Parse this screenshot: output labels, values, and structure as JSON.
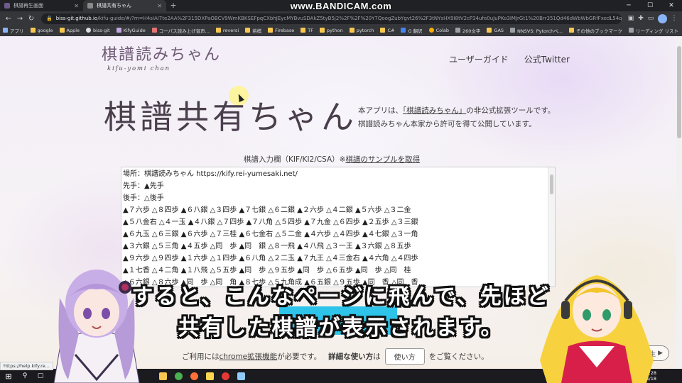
{
  "watermark": "www.BANDICAM.com",
  "browser": {
    "tabs": [
      {
        "title": "棋譜再生画面",
        "favicon_color": "#6f5a8c",
        "active": false
      },
      {
        "title": "棋譜共有ちゃん",
        "favicon_color": "#8a8a8a",
        "active": true
      }
    ],
    "new_tab": "+",
    "url_host": "biss-git.github.io",
    "url_path": "/kifu-guide/#/?m=H4sIAI7te2AA%2F315DXPaOBCV9WmKBKSEFpqCXbhJEycMYBvuSDAkZ5tyB5j2%2F%2F%20Y7QoogZubYgvt26%2F3tNYsHX9I8tV2cP34ufe0uJuPKo3IMJrGt1%20Brr351Qd46dWbWbGRfFxedL54qu3ewxZCgCgHWPbDb...",
    "bookmarks": [
      "アプリ",
      "google",
      "Apple",
      "biss-git",
      "KifyGuide",
      "コーパス読み上げ音声...",
      "reversi",
      "将棋",
      "Firebase",
      "TF",
      "python",
      "pytorch",
      "C#",
      "G 翻訳",
      "Colab",
      "260文字",
      "GAS",
      "NNSVS: Pytorchベ..."
    ],
    "bookmarks_right": [
      "その他のブックマーク",
      "リーディング リスト"
    ]
  },
  "header": {
    "logo_title": "棋譜読みちゃん",
    "logo_subtitle": "kifu-yomi chan",
    "nav": [
      "ユーザーガイド",
      "公式Twitter"
    ]
  },
  "hero": {
    "title": "棋譜共有ちゃん",
    "desc_pre": "本アプリは、",
    "desc_link": "「棋譜読みちゃん」",
    "desc_post": "の非公式拡張ツールです。",
    "desc_line2": "棋譜読みちゃん本家から許可を得て公開しています。"
  },
  "input": {
    "label": "棋譜入力欄（KIF/KI2/CSA）※",
    "sample_link": "棋譜のサンプルを取得",
    "lines": [
      "場所：棋譜読みちゃん https://kify.rei-yumesaki.net/",
      "先手：▲先手",
      "後手：△後手",
      "▲７六歩 △８四歩 ▲６八銀 △３四歩 ▲７七銀 △６二銀 ▲２六歩 △４二銀 ▲５六歩 △３二金",
      "▲５八金右 △４一玉 ▲４八銀 △７四歩 ▲７八角 △５四歩 ▲７九金 △６四歩 ▲２五歩 △３三銀",
      "▲６九玉 △６三銀 ▲６六歩 △７三桂 ▲６七金右 △５二金 ▲４六歩 △４四歩 ▲４七銀 △３一角",
      "▲３六銀 △５三角 ▲４五歩 △同　歩 ▲同　銀 △８一飛 ▲４八飛 △３一王 ▲３六銀 △８五歩",
      "▲９六歩 △９四歩 ▲１六歩 △１四歩 ▲６八角 △２二玉 ▲７九王 △４三金右 ▲４六角 △４四歩",
      "▲１七香 △４二角 ▲１八飛 △５五歩 ▲同　歩 △９五歩 ▲同　歩 △６五歩 ▲同　歩 △同　桂",
      "▲６六銀 △８六歩 ▲同　歩 △同　角 ▲８七歩 △５九角成 ▲６五銀 △９五歩 ▲同　香 △同　香"
    ]
  },
  "footer": {
    "pre": "ご利用には",
    "link": "chrome拡張機能",
    "mid": "が必要です。",
    "bold": "詳細な使い方",
    "bold_post": "は",
    "button": "使い方",
    "post": "をご覧ください。",
    "ghost_button": "棋譜再生"
  },
  "subtitles": {
    "line1": "すると、こんなページに飛んで、先ほど",
    "line2": "共有した棋譜が表示されます。"
  },
  "status_url": "https://help.kify.re...",
  "taskbar": {
    "time": "17:28",
    "date": "2021/04/18"
  },
  "colors": {
    "highlight": "#2ec3e8",
    "logo": "#6e5a74",
    "hero": "#4a3f4c"
  }
}
